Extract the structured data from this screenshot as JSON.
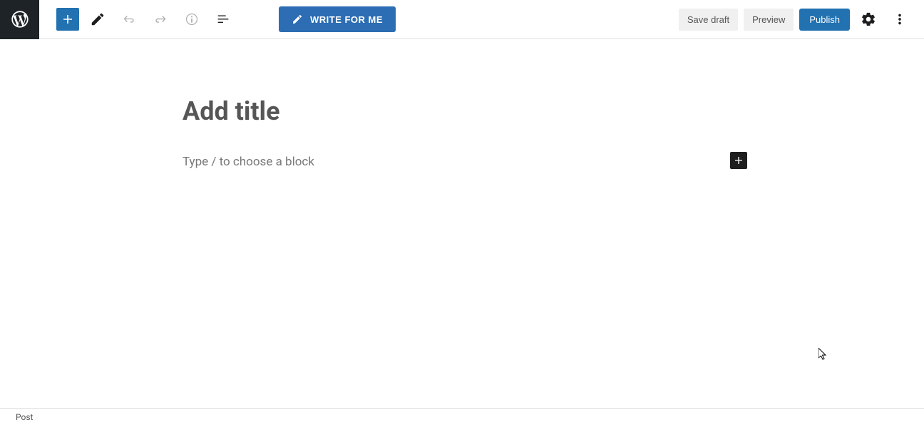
{
  "toolbar": {
    "write_for_me_label": "WRITE FOR ME",
    "save_draft_label": "Save draft",
    "preview_label": "Preview",
    "publish_label": "Publish"
  },
  "editor": {
    "title_placeholder": "Add title",
    "block_placeholder": "Type / to choose a block"
  },
  "footer": {
    "breadcrumb": "Post"
  }
}
